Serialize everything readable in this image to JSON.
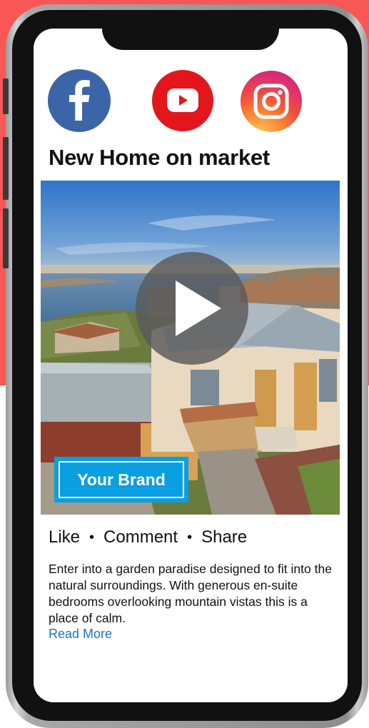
{
  "colors": {
    "background_accent": "#f95656",
    "facebook": "#3b65a7",
    "youtube": "#e3161e",
    "brand_badge": "#0a9fe1",
    "link": "#1f73bd"
  },
  "social": [
    {
      "icon": "facebook-icon"
    },
    {
      "icon": "youtube-icon"
    },
    {
      "icon": "instagram-icon"
    }
  ],
  "post": {
    "title": "New Home on market",
    "media": {
      "image": "aerial photo of a house overlooking a lake",
      "overlay_icon": "play-icon",
      "brand_label": "Your Brand"
    },
    "actions": {
      "like": "Like",
      "comment": "Comment",
      "share": "Share",
      "separator": "•"
    },
    "description": "Enter into a garden paradise designed to fit into the natural surroundings. With generous en-suite bedrooms overlooking mountain vistas this is a place of calm.",
    "read_more": "Read More"
  }
}
